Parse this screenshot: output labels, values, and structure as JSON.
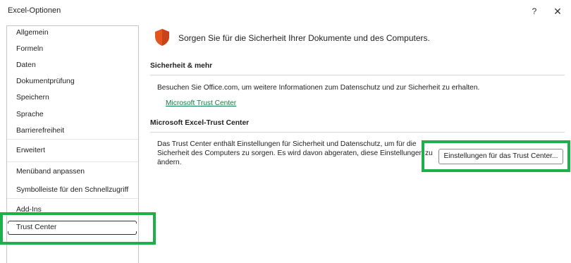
{
  "window": {
    "title": "Excel-Optionen",
    "help_label": "?",
    "close_label": "✕"
  },
  "sidebar": {
    "items": [
      {
        "label": "Allgemein"
      },
      {
        "label": "Formeln"
      },
      {
        "label": "Daten"
      },
      {
        "label": "Dokumentprüfung"
      },
      {
        "label": "Speichern"
      },
      {
        "label": "Sprache"
      },
      {
        "label": "Barrierefreiheit"
      },
      {
        "label": "Erweitert"
      },
      {
        "label": "Menüband anpassen"
      },
      {
        "label": "Symbolleiste für den Schnellzugriff"
      },
      {
        "label": "Add-Ins"
      },
      {
        "label": "Trust Center"
      }
    ],
    "selected": "Trust Center"
  },
  "main": {
    "header_text": "Sorgen Sie für die Sicherheit Ihrer Dokumente und des Computers.",
    "header_icon": "shield-icon",
    "section1": {
      "title": "Sicherheit & mehr",
      "text": "Besuchen Sie Office.com, um weitere Informationen zum Datenschutz und zur Sicherheit zu erhalten.",
      "link": "Microsoft Trust Center"
    },
    "section2": {
      "title": "Microsoft Excel-Trust Center",
      "text_line1": "Das Trust Center enthält Einstellungen für Sicherheit und Datenschutz, um für die",
      "text_line2": "Sicherheit des Computers zu sorgen. Es wird davon abgeraten, diese Einstellungen zu",
      "text_line3": "ändern.",
      "button": "Einstellungen für das Trust Center..."
    }
  },
  "colors": {
    "highlight": "#1faf4a",
    "link": "#107c41",
    "shield": "#e2561e"
  }
}
